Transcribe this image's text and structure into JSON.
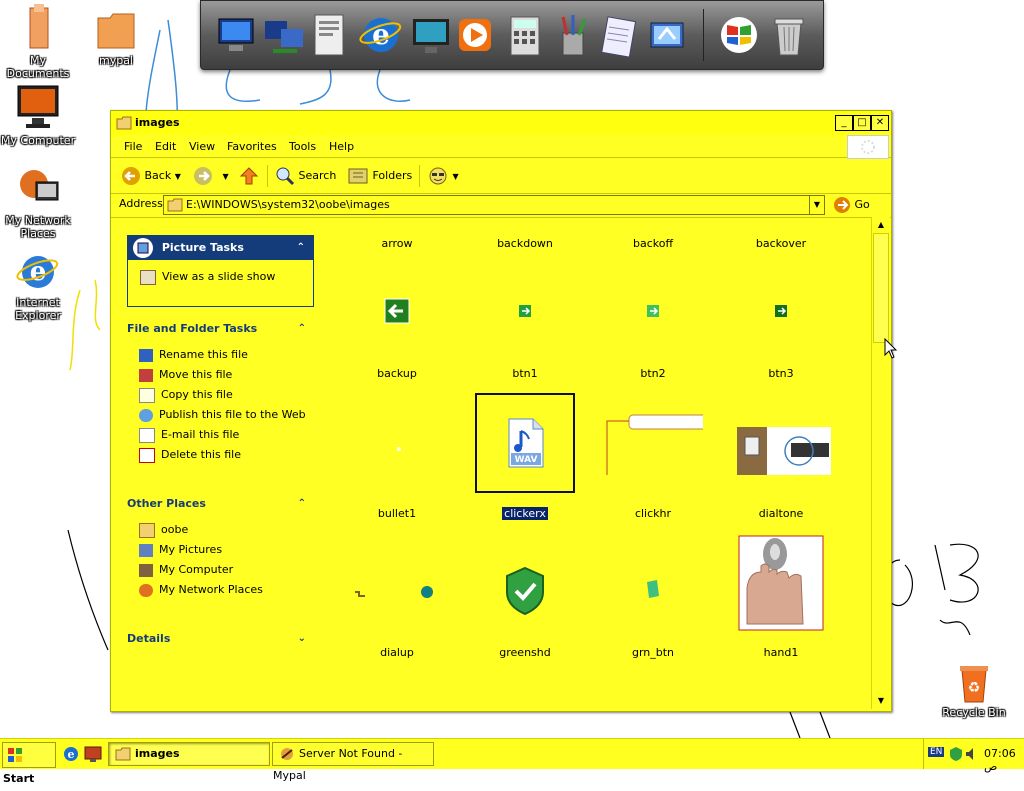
{
  "desktop": {
    "icons": [
      {
        "label": "My Documents"
      },
      {
        "label": "mypal"
      },
      {
        "label": "My Computer"
      },
      {
        "label": "My Network Places"
      },
      {
        "label": "Internet Explorer"
      },
      {
        "label": "Recycle Bin"
      }
    ]
  },
  "window": {
    "title": "images",
    "menu": [
      "File",
      "Edit",
      "View",
      "Favorites",
      "Tools",
      "Help"
    ],
    "toolbar": {
      "back": "Back",
      "search": "Search",
      "folders": "Folders"
    },
    "address": {
      "label": "Address",
      "value": "E:\\WINDOWS\\system32\\oobe\\images",
      "go": "Go"
    },
    "picture_tasks": {
      "title": "Picture Tasks",
      "items": [
        "View as a slide show"
      ]
    },
    "file_tasks": {
      "title": "File and Folder Tasks",
      "items": [
        "Rename this file",
        "Move this file",
        "Copy this file",
        "Publish this file to the Web",
        "E-mail this file",
        "Delete this file"
      ]
    },
    "other_places": {
      "title": "Other Places",
      "items": [
        "oobe",
        "My Pictures",
        "My Computer",
        "My Network Places"
      ]
    },
    "details": {
      "title": "Details"
    },
    "files": [
      {
        "name": "arrow"
      },
      {
        "name": "backdown"
      },
      {
        "name": "backoff"
      },
      {
        "name": "backover"
      },
      {
        "name": "backup"
      },
      {
        "name": "btn1"
      },
      {
        "name": "btn2"
      },
      {
        "name": "btn3"
      },
      {
        "name": "bullet1"
      },
      {
        "name": "clickerx",
        "selected": true
      },
      {
        "name": "clickhr"
      },
      {
        "name": "dialtone"
      },
      {
        "name": "dialup"
      },
      {
        "name": "greenshd"
      },
      {
        "name": "grn_btn"
      },
      {
        "name": "hand1"
      }
    ]
  },
  "taskbar": {
    "start": "Start",
    "tasks": [
      "images",
      "Server Not Found - Mypal"
    ],
    "tray_lang": "EN",
    "clock": "07:06 ص"
  },
  "colors": {
    "window_bg": "#ffff24",
    "task_header": "#143b7a",
    "selection": "#0a246a"
  }
}
